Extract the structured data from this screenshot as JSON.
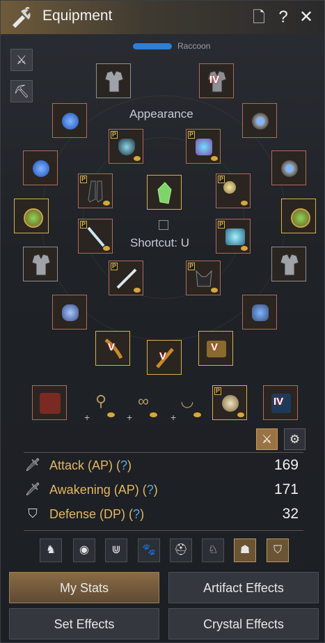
{
  "window": {
    "title": "Equipment",
    "character_name_visible": "Raccoon"
  },
  "titlebar_buttons": {
    "document": "🗋",
    "help": "?",
    "close": "✕"
  },
  "center": {
    "appearance_label": "Appearance",
    "shortcut_label": "Shortcut: U"
  },
  "badges": {
    "preset": "P",
    "tier_v": "V",
    "tier_iv": "IV"
  },
  "stats": [
    {
      "label": "Attack (AP)",
      "help": "?",
      "value": "169"
    },
    {
      "label": "Awakening (AP)",
      "help": "?",
      "value": "171"
    },
    {
      "label": "Defense (DP)",
      "help": "?",
      "value": "32"
    }
  ],
  "tabs": {
    "my_stats": "My Stats",
    "artifact_effects": "Artifact Effects",
    "set_effects": "Set Effects",
    "crystal_effects": "Crystal Effects"
  },
  "colors": {
    "slot_border_red": "#b06b5d",
    "slot_border_gold": "#d8b24b",
    "stat_label": "#e3b85f",
    "help_blue": "#5aa7e6",
    "tab_active": "#8a6b45"
  }
}
